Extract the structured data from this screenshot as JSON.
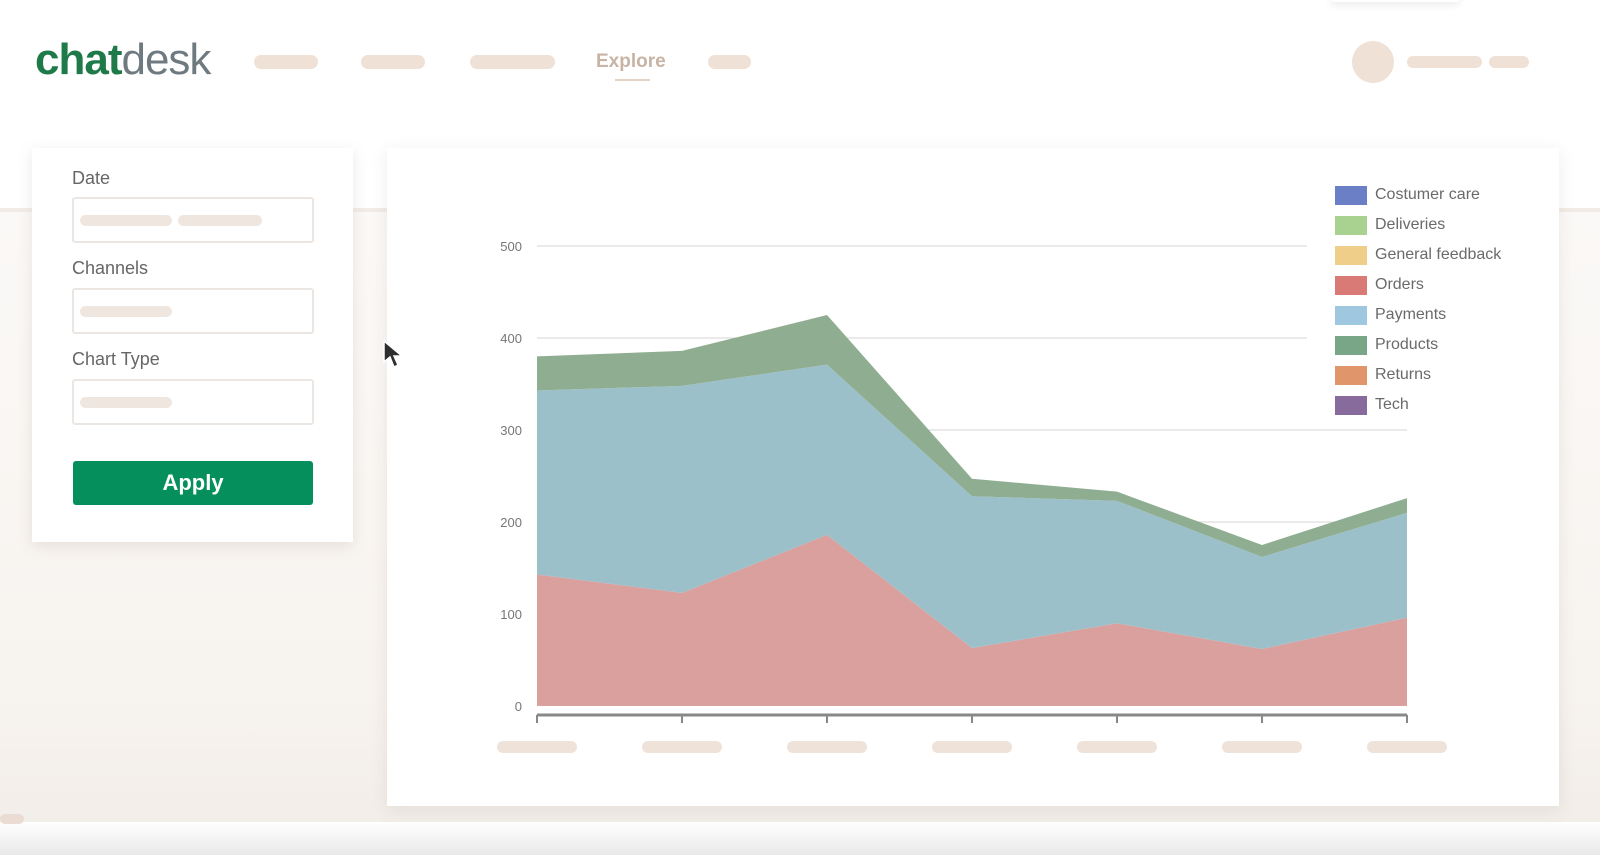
{
  "app": {
    "logo_part1": "chat",
    "logo_part2": "desk"
  },
  "nav": {
    "active_label": "Explore"
  },
  "filters": {
    "date_label": "Date",
    "channels_label": "Channels",
    "chart_type_label": "Chart Type",
    "apply_label": "Apply"
  },
  "chart_data": {
    "type": "area",
    "stacked": true,
    "title": "",
    "xlabel": "",
    "ylabel": "",
    "ylim": [
      0,
      500
    ],
    "yticks": [
      0,
      100,
      200,
      300,
      400,
      500
    ],
    "grid": true,
    "legend_position": "top-right",
    "point_count": 7,
    "series": [
      {
        "name": "Orders",
        "color": "#d9a09e",
        "values": [
          143,
          123,
          186,
          63,
          90,
          62,
          96
        ]
      },
      {
        "name": "Payments",
        "color": "#9cc0ca",
        "values": [
          200,
          225,
          185,
          165,
          133,
          100,
          114
        ]
      },
      {
        "name": "Products",
        "color": "#8fae91",
        "values": [
          37,
          38,
          54,
          19,
          10,
          13,
          16
        ]
      }
    ],
    "legend": [
      {
        "name": "Costumer care",
        "color": "#6a7fc6"
      },
      {
        "name": "Deliveries",
        "color": "#a9d190"
      },
      {
        "name": "General feedback",
        "color": "#eece88"
      },
      {
        "name": "Orders",
        "color": "#d97a76"
      },
      {
        "name": "Payments",
        "color": "#9fc8e0"
      },
      {
        "name": "Products",
        "color": "#79a686"
      },
      {
        "name": "Returns",
        "color": "#e0956a"
      },
      {
        "name": "Tech",
        "color": "#876b9d"
      }
    ]
  }
}
